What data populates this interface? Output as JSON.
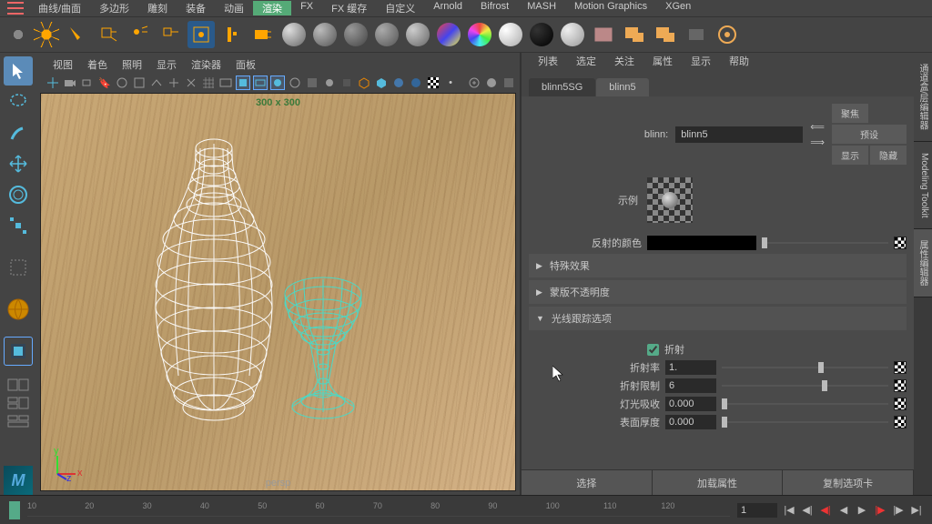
{
  "menubar": {
    "items": [
      "曲线/曲面",
      "多边形",
      "雕刻",
      "装备",
      "动画",
      "渲染",
      "FX",
      "FX 缓存",
      "自定义",
      "Arnold",
      "Bifrost",
      "MASH",
      "Motion Graphics",
      "XGen"
    ],
    "active": 5
  },
  "viewport": {
    "menus": [
      "视图",
      "着色",
      "照明",
      "显示",
      "渲染器",
      "面板"
    ],
    "dimensions": "300 x 300",
    "camera": "persp"
  },
  "attr": {
    "menus": [
      "列表",
      "选定",
      "关注",
      "属性",
      "显示",
      "帮助"
    ],
    "tabs": [
      "blinn5SG",
      "blinn5"
    ],
    "activeTab": 1,
    "typeLabel": "blinn:",
    "nodeName": "blinn5",
    "btns": {
      "focus": "聚焦",
      "preset": "预设",
      "show": "显示",
      "hide": "隐藏"
    },
    "swatchLabel": "示例",
    "reflLabel": "反射的颜色",
    "sections": {
      "fx": "特殊效果",
      "matte": "蒙版不透明度",
      "ray": "光线跟踪选项"
    },
    "ray": {
      "refractCheck": "折射",
      "params": [
        {
          "label": "折射率",
          "value": "1.",
          "thumb": 58
        },
        {
          "label": "折射限制",
          "value": "6",
          "thumb": 60
        },
        {
          "label": "灯光吸收",
          "value": "0.000",
          "thumb": 0
        },
        {
          "label": "表面厚度",
          "value": "0.000",
          "thumb": 0
        }
      ]
    },
    "bottomBtns": [
      "选择",
      "加载属性",
      "复制选项卡"
    ]
  },
  "rightTabs": [
    "通道盒/层编辑器",
    "Modeling Toolkit",
    "属性编辑器"
  ],
  "timeline": {
    "ticks": [
      10,
      20,
      30,
      40,
      50,
      60,
      70,
      80,
      90,
      100,
      110,
      120
    ],
    "ticks2": [
      50,
      60,
      70,
      80,
      90,
      100,
      110,
      120
    ],
    "current": "1",
    "end": "120"
  }
}
